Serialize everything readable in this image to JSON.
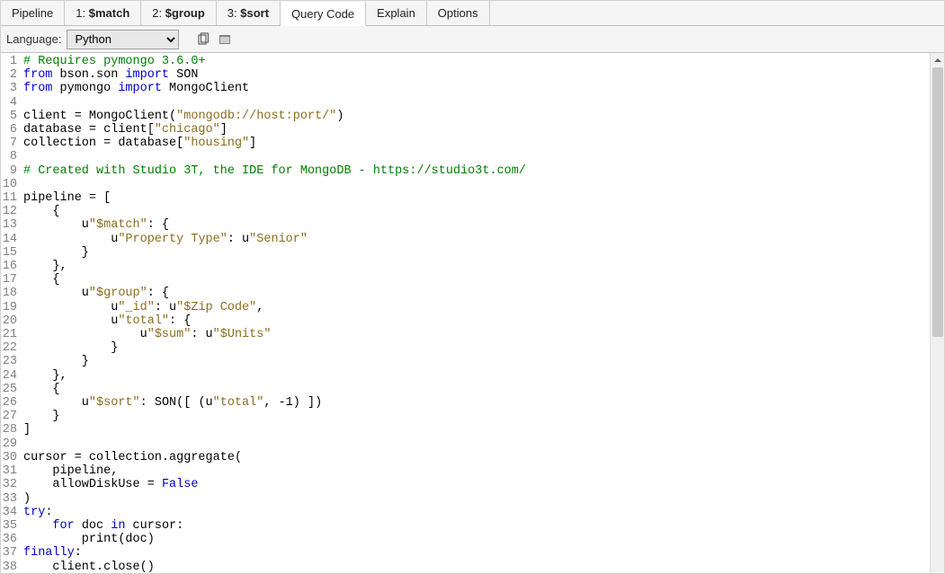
{
  "tabs": [
    {
      "label": "Pipeline",
      "active": false,
      "bold": false
    },
    {
      "prefix": "1: ",
      "label": "$match",
      "active": false,
      "bold": true
    },
    {
      "prefix": "2: ",
      "label": "$group",
      "active": false,
      "bold": true
    },
    {
      "prefix": "3: ",
      "label": "$sort",
      "active": false,
      "bold": true
    },
    {
      "label": "Query Code",
      "active": true,
      "bold": false
    },
    {
      "label": "Explain",
      "active": false,
      "bold": false
    },
    {
      "label": "Options",
      "active": false,
      "bold": false
    }
  ],
  "toolbar": {
    "language_label": "Language:",
    "language_value": "Python",
    "copy_icon_name": "copy-icon",
    "expand_icon_name": "expand-icon"
  },
  "code": {
    "lines": [
      [
        {
          "t": "# Requires pymongo 3.6.0+",
          "c": "c-comment"
        }
      ],
      [
        {
          "t": "from",
          "c": "c-kw"
        },
        {
          "t": " bson.son "
        },
        {
          "t": "import",
          "c": "c-kw"
        },
        {
          "t": " SON"
        }
      ],
      [
        {
          "t": "from",
          "c": "c-kw"
        },
        {
          "t": " pymongo "
        },
        {
          "t": "import",
          "c": "c-kw"
        },
        {
          "t": " MongoClient"
        }
      ],
      [],
      [
        {
          "t": "client = MongoClient("
        },
        {
          "t": "\"mongodb://host:port/\"",
          "c": "c-str"
        },
        {
          "t": ")"
        }
      ],
      [
        {
          "t": "database = client["
        },
        {
          "t": "\"chicago\"",
          "c": "c-str"
        },
        {
          "t": "]"
        }
      ],
      [
        {
          "t": "collection = database["
        },
        {
          "t": "\"housing\"",
          "c": "c-str"
        },
        {
          "t": "]"
        }
      ],
      [],
      [
        {
          "t": "# Created with Studio 3T, the IDE for MongoDB - https://studio3t.com/",
          "c": "c-comment"
        }
      ],
      [],
      [
        {
          "t": "pipeline = ["
        }
      ],
      [
        {
          "t": "    {"
        }
      ],
      [
        {
          "t": "        u"
        },
        {
          "t": "\"$match\"",
          "c": "c-str"
        },
        {
          "t": ": {"
        }
      ],
      [
        {
          "t": "            u"
        },
        {
          "t": "\"Property Type\"",
          "c": "c-str"
        },
        {
          "t": ": u"
        },
        {
          "t": "\"Senior\"",
          "c": "c-str"
        }
      ],
      [
        {
          "t": "        }"
        }
      ],
      [
        {
          "t": "    },"
        }
      ],
      [
        {
          "t": "    {"
        }
      ],
      [
        {
          "t": "        u"
        },
        {
          "t": "\"$group\"",
          "c": "c-str"
        },
        {
          "t": ": {"
        }
      ],
      [
        {
          "t": "            u"
        },
        {
          "t": "\"_id\"",
          "c": "c-str"
        },
        {
          "t": ": u"
        },
        {
          "t": "\"$Zip Code\"",
          "c": "c-str"
        },
        {
          "t": ","
        }
      ],
      [
        {
          "t": "            u"
        },
        {
          "t": "\"total\"",
          "c": "c-str"
        },
        {
          "t": ": {"
        }
      ],
      [
        {
          "t": "                u"
        },
        {
          "t": "\"$sum\"",
          "c": "c-str"
        },
        {
          "t": ": u"
        },
        {
          "t": "\"$Units\"",
          "c": "c-str"
        }
      ],
      [
        {
          "t": "            }"
        }
      ],
      [
        {
          "t": "        }"
        }
      ],
      [
        {
          "t": "    },"
        }
      ],
      [
        {
          "t": "    {"
        }
      ],
      [
        {
          "t": "        u"
        },
        {
          "t": "\"$sort\"",
          "c": "c-str"
        },
        {
          "t": ": SON([ (u"
        },
        {
          "t": "\"total\"",
          "c": "c-str"
        },
        {
          "t": ", -1) ])"
        }
      ],
      [
        {
          "t": "    }"
        }
      ],
      [
        {
          "t": "]"
        }
      ],
      [],
      [
        {
          "t": "cursor = collection.aggregate("
        }
      ],
      [
        {
          "t": "    pipeline,"
        }
      ],
      [
        {
          "t": "    allowDiskUse = "
        },
        {
          "t": "False",
          "c": "c-bool"
        }
      ],
      [
        {
          "t": ")"
        }
      ],
      [
        {
          "t": "try",
          "c": "c-kw"
        },
        {
          "t": ":"
        }
      ],
      [
        {
          "t": "    "
        },
        {
          "t": "for",
          "c": "c-kw"
        },
        {
          "t": " doc "
        },
        {
          "t": "in",
          "c": "c-kw"
        },
        {
          "t": " cursor:"
        }
      ],
      [
        {
          "t": "        print(doc)"
        }
      ],
      [
        {
          "t": "finally",
          "c": "c-kw"
        },
        {
          "t": ":"
        }
      ],
      [
        {
          "t": "    client.close()"
        }
      ]
    ]
  }
}
